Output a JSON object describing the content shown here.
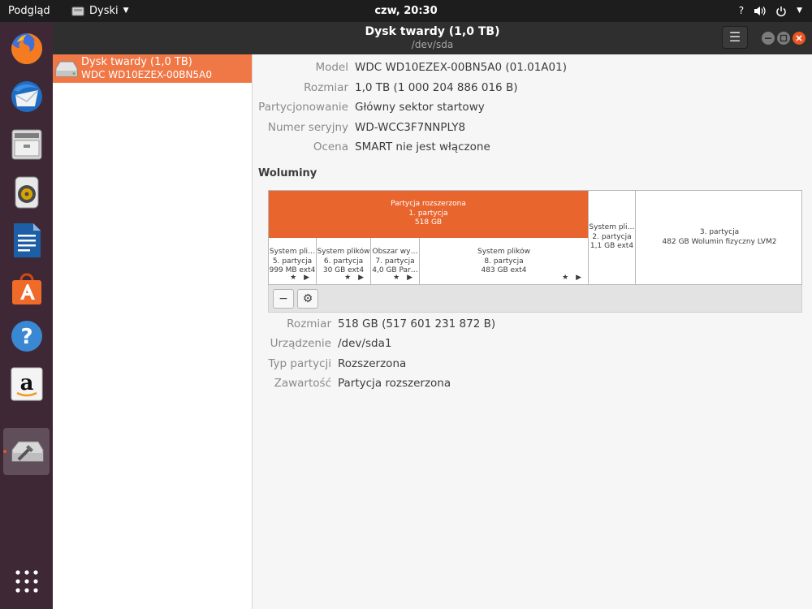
{
  "top_panel": {
    "activities": "Podgląd",
    "app_name": "Dyski",
    "clock": "czw, 20:30",
    "help": "?",
    "icons": [
      "volume-icon",
      "power-icon"
    ]
  },
  "dock": {
    "items": [
      "firefox",
      "thunderbird",
      "files",
      "rhythmbox",
      "libreoffice-writer",
      "ubuntu-software",
      "help",
      "amazon",
      "disks"
    ],
    "active": "disks"
  },
  "header": {
    "title": "Dysk twardy (1,0 TB)",
    "subtitle": "/dev/sda"
  },
  "sidebar": {
    "drive": {
      "name": "Dysk twardy (1,0 TB)",
      "model": "WDC WD10EZEX-00BN5A0"
    }
  },
  "details": {
    "model_label": "Model",
    "model_value": "WDC WD10EZEX-00BN5A0 (01.01A01)",
    "size_label": "Rozmiar",
    "size_value": "1,0 TB (1 000 204 886 016 B)",
    "partitioning_label": "Partycjonowanie",
    "partitioning_value": "Główny sektor startowy",
    "serial_label": "Numer seryjny",
    "serial_value": "WD-WCC3F7NNPLY8",
    "rating_label": "Ocena",
    "rating_value": "SMART nie jest włączone"
  },
  "volumes": {
    "title": "Woluminy",
    "top": [
      {
        "lines": [
          "Partycja rozszerzona",
          "1. partycja",
          "518 GB"
        ]
      },
      {
        "lines": [
          "System pli…",
          "2. partycja",
          "1,1 GB ext4"
        ]
      },
      {
        "lines": [
          "3. partycja",
          "482 GB Wolumin fizyczny LVM2"
        ]
      }
    ],
    "logical": [
      {
        "lines": [
          "System pli…",
          "5. partycja",
          "999 MB ext4"
        ]
      },
      {
        "lines": [
          "System plików",
          "6. partycja",
          "30 GB ext4"
        ]
      },
      {
        "lines": [
          "Obszar wy…",
          "7. partycja",
          "4,0 GB Par…"
        ]
      },
      {
        "lines": [
          "System plików",
          "8. partycja",
          "483 GB ext4"
        ]
      }
    ],
    "markers": "★ ▶"
  },
  "toolbar": {
    "remove": "−",
    "settings": "⚙"
  },
  "partition": {
    "size_label": "Rozmiar",
    "size_value": "518 GB (517 601 231 872 B)",
    "device_label": "Urządzenie",
    "device_value": "/dev/sda1",
    "type_label": "Typ partycji",
    "type_value": "Rozszerzona",
    "contents_label": "Zawartość",
    "contents_value": "Partycja rozszerzona"
  },
  "colors": {
    "accent": "#e95420",
    "selected_partition": "#e9652e",
    "dock": "#3e2836",
    "panel": "#1d1d1d",
    "header": "#2f2f2f"
  }
}
